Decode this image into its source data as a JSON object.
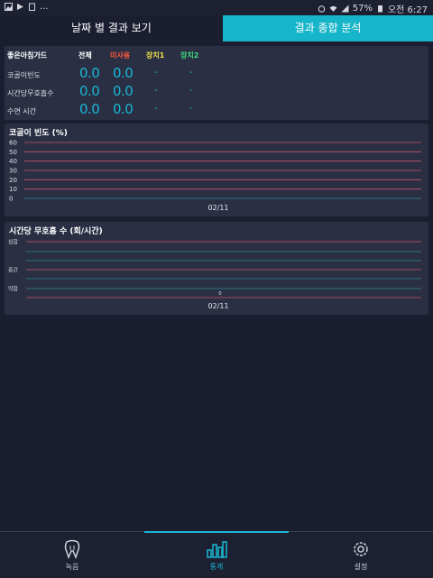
{
  "statusbar": {
    "battery": "57%",
    "time": "오전 6:27",
    "dots": "..."
  },
  "tabs": [
    {
      "label": "날짜 별 결과 보기"
    },
    {
      "label": "결과 종합 분석"
    }
  ],
  "summary": {
    "title": "좋은아침가드",
    "columns": [
      "전체",
      "미사용",
      "장치1",
      "장치2"
    ],
    "rows": [
      {
        "label": "코골이빈도",
        "total": "0.0",
        "unused": "0.0",
        "device1": "-",
        "device2": "-"
      },
      {
        "label": "시간당무호흡수",
        "total": "0.0",
        "unused": "0.0",
        "device1": "-",
        "device2": "-"
      },
      {
        "label": "수면 시간",
        "total": "0.0",
        "unused": "0.0",
        "device1": "-",
        "device2": "-"
      }
    ]
  },
  "snore_chart": {
    "title": "코골이 빈도 (%)",
    "xlabel": "02/11",
    "ytick_labels": [
      "60",
      "50",
      "40",
      "30",
      "20",
      "10",
      "0"
    ]
  },
  "apnea_chart": {
    "title": "시간당 무호흡 수 (회/시간)",
    "xlabel": "02/11",
    "level_labels": [
      "심함",
      "중간",
      "약함"
    ],
    "point_label": "0"
  },
  "chart_data": [
    {
      "type": "line",
      "title": "코골이 빈도 (%)",
      "categories": [
        "02/11"
      ],
      "values": [],
      "ylim": [
        0,
        60
      ],
      "grid": true
    },
    {
      "type": "scatter",
      "title": "시간당 무호흡 수 (회/시간)",
      "categories": [
        "02/11"
      ],
      "values": [
        0
      ],
      "grid": true
    }
  ],
  "bottomnav": [
    {
      "label": "녹음",
      "icon": "tooth-icon"
    },
    {
      "label": "통계",
      "icon": "bar-chart-icon"
    },
    {
      "label": "설정",
      "icon": "gear-icon"
    }
  ],
  "colors": {
    "accent": "#1ab7d6",
    "tab_active": "#17b5c9",
    "grid_red": "#c8566a",
    "grid_teal": "#2a8a93",
    "unused": "#ff5a3c",
    "device1": "#f2e34b",
    "device2": "#3fe07a"
  }
}
